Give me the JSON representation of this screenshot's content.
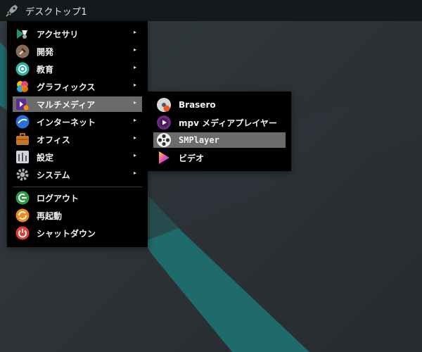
{
  "topbar": {
    "title": "デスクトップ1",
    "icon": "rocket-icon"
  },
  "menu": {
    "items": [
      {
        "label": "アクセサリ",
        "icon": "accessories-icon",
        "has_submenu": true
      },
      {
        "label": "開発",
        "icon": "development-icon",
        "has_submenu": true
      },
      {
        "label": "教育",
        "icon": "education-icon",
        "has_submenu": true
      },
      {
        "label": "グラフィックス",
        "icon": "graphics-icon",
        "has_submenu": true
      },
      {
        "label": "マルチメディア",
        "icon": "multimedia-icon",
        "has_submenu": true,
        "active": true
      },
      {
        "label": "インターネット",
        "icon": "internet-icon",
        "has_submenu": true
      },
      {
        "label": "オフィス",
        "icon": "office-icon",
        "has_submenu": true
      },
      {
        "label": "設定",
        "icon": "settings-icon",
        "has_submenu": true
      },
      {
        "label": "システム",
        "icon": "system-icon",
        "has_submenu": true
      }
    ],
    "actions": [
      {
        "label": "ログアウト",
        "icon": "logout-icon"
      },
      {
        "label": "再起動",
        "icon": "restart-icon"
      },
      {
        "label": "シャットダウン",
        "icon": "shutdown-icon"
      }
    ],
    "arrow": "▸"
  },
  "submenu": {
    "items": [
      {
        "label": "Brasero",
        "icon": "brasero-icon"
      },
      {
        "label": "mpv メディアプレイヤー",
        "icon": "mpv-icon"
      },
      {
        "label": "SMPlayer",
        "icon": "smplayer-icon",
        "active": true
      },
      {
        "label": "ビデオ",
        "icon": "video-icon"
      }
    ]
  },
  "colors": {
    "menu_bg": "#000000",
    "highlight": "#6b6b6b",
    "accent_teal": "#1f6a6b",
    "topbar_bg": "#15191b"
  }
}
